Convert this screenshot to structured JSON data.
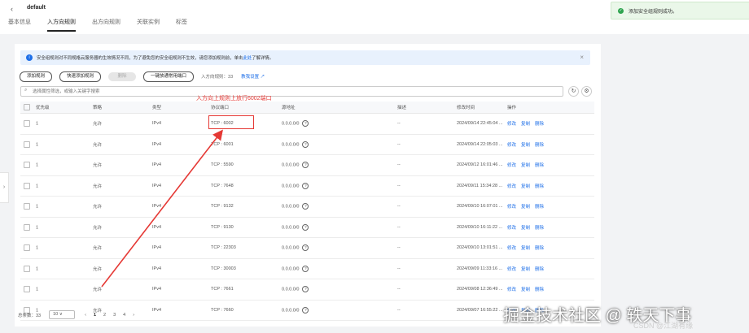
{
  "header": {
    "back_icon": "chevron-left-icon",
    "title": "default",
    "tabs": [
      {
        "label": "基本信息",
        "active": false
      },
      {
        "label": "入方向规则",
        "active": true
      },
      {
        "label": "出方向规则",
        "active": false
      },
      {
        "label": "关联实例",
        "active": false
      },
      {
        "label": "标签",
        "active": false
      }
    ]
  },
  "toast": {
    "message": "添加安全组规则成功。",
    "color": "#2ea44f"
  },
  "notice": {
    "text": "安全组规则对不同规格云服务器的生效情况不同，为了避免您的安全组规则不生效，请您添加规则前，单击",
    "link": "此处",
    "tail": "了解详情。"
  },
  "toolbar": {
    "add_rule": "添加规则",
    "quick_add": "快速添加规则",
    "delete": "删除",
    "one_click": "一键放通常用端口",
    "rule_count": "入方向规则：33",
    "help_link": "教我设置"
  },
  "search": {
    "placeholder": "选择属性筛选，或输入关键字搜索"
  },
  "table": {
    "headers": [
      "优先级",
      "策略",
      "类型",
      "协议端口",
      "源地址",
      "描述",
      "修改时间",
      "操作"
    ],
    "rows": [
      {
        "priority": "1",
        "policy": "允许",
        "type": "IPv4",
        "port": "TCP : 6002",
        "source": "0.0.0.0/0",
        "desc": "--",
        "time": "2024/09/14 22:45:04 ..."
      },
      {
        "priority": "1",
        "policy": "允许",
        "type": "IPv4",
        "port": "TCP : 6001",
        "source": "0.0.0.0/0",
        "desc": "--",
        "time": "2024/09/14 22:05:03 ..."
      },
      {
        "priority": "1",
        "policy": "允许",
        "type": "IPv4",
        "port": "TCP : 5590",
        "source": "0.0.0.0/0",
        "desc": "--",
        "time": "2024/09/12 16:01:46 ..."
      },
      {
        "priority": "1",
        "policy": "允许",
        "type": "IPv4",
        "port": "TCP : 7648",
        "source": "0.0.0.0/0",
        "desc": "--",
        "time": "2024/09/11 15:34:28 ..."
      },
      {
        "priority": "1",
        "policy": "允许",
        "type": "IPv4",
        "port": "TCP : 9132",
        "source": "0.0.0.0/0",
        "desc": "--",
        "time": "2024/09/10 16:07:01 ..."
      },
      {
        "priority": "1",
        "policy": "允许",
        "type": "IPv4",
        "port": "TCP : 9130",
        "source": "0.0.0.0/0",
        "desc": "--",
        "time": "2024/09/10 16:11:22 ..."
      },
      {
        "priority": "1",
        "policy": "允许",
        "type": "IPv4",
        "port": "TCP : 22303",
        "source": "0.0.0.0/0",
        "desc": "--",
        "time": "2024/09/10 13:01:51 ..."
      },
      {
        "priority": "1",
        "policy": "允许",
        "type": "IPv4",
        "port": "TCP : 30003",
        "source": "0.0.0.0/0",
        "desc": "--",
        "time": "2024/09/09 11:33:16 ..."
      },
      {
        "priority": "1",
        "policy": "允许",
        "type": "IPv4",
        "port": "TCP : 7661",
        "source": "0.0.0.0/0",
        "desc": "--",
        "time": "2024/09/08 12:36:49 ..."
      },
      {
        "priority": "1",
        "policy": "允许",
        "type": "IPv4",
        "port": "TCP : 7660",
        "source": "0.0.0.0/0",
        "desc": "--",
        "time": "2024/09/07 16:55:22 ..."
      }
    ],
    "actions": [
      "修改",
      "复制",
      "删除"
    ]
  },
  "pager": {
    "total": "总条数：33",
    "page_size": "10",
    "pages": [
      "1",
      "2",
      "3",
      "4"
    ],
    "current": "1"
  },
  "annotation": {
    "text": "入方向上规则上放行6002端口",
    "color": "#e53935"
  },
  "watermark": {
    "text": "掘金技术社区 @ 轶天下事",
    "csdn": "CSDN @江湖有缘"
  }
}
